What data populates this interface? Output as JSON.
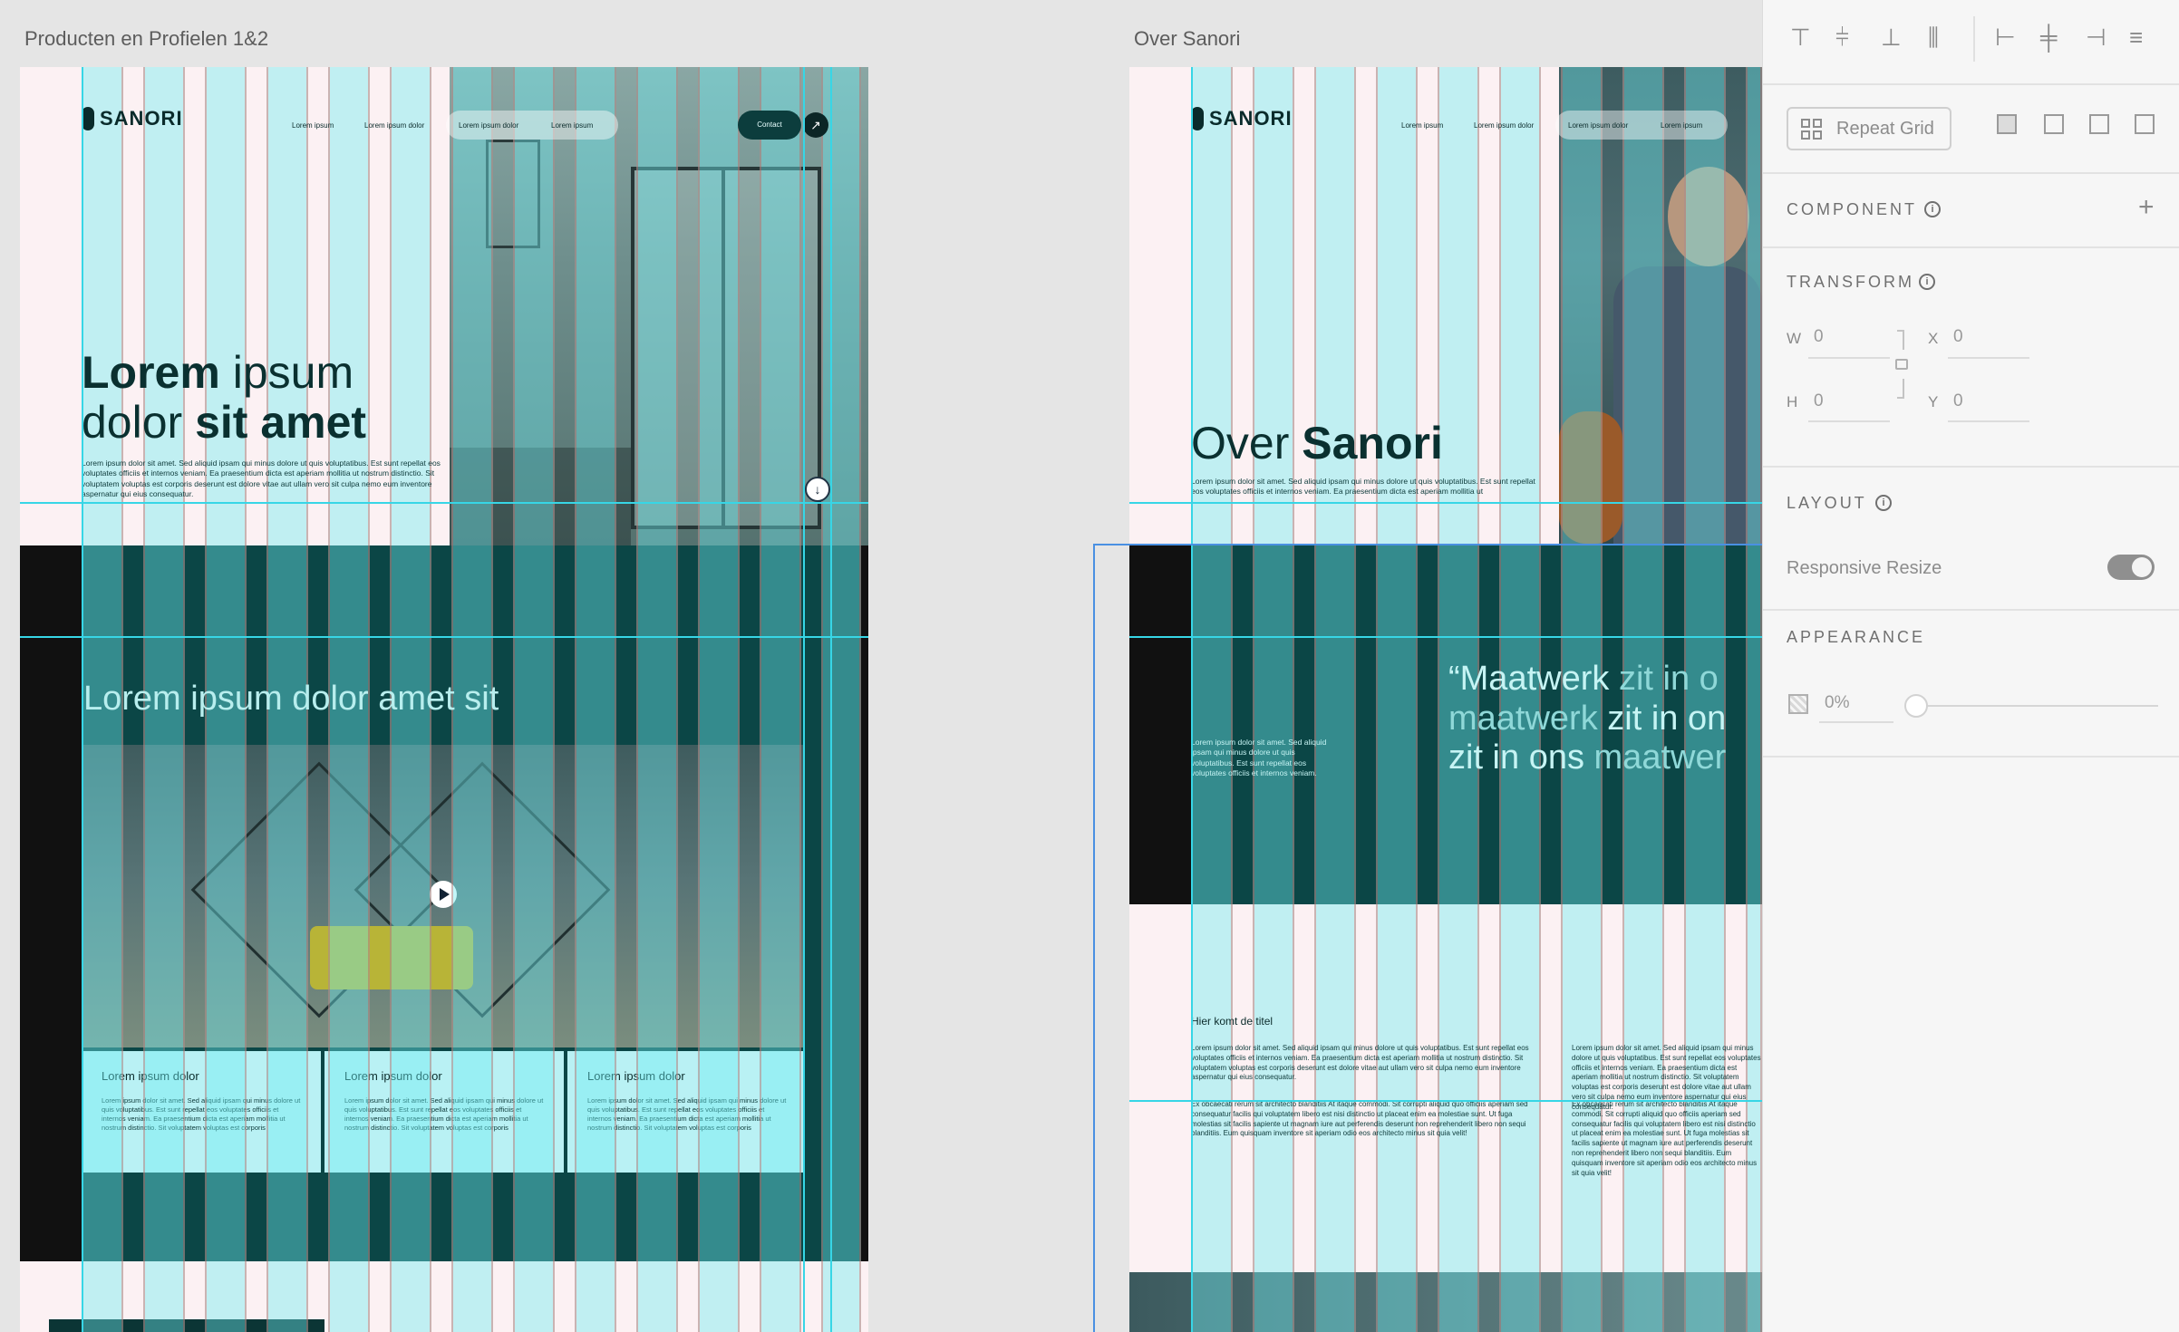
{
  "artboards": {
    "left": {
      "title": "Producten en Profielen 1&2",
      "logo": "SANORI",
      "nav": [
        "Lorem ipsum",
        "Lorem ipsum dolor",
        "Lorem ipsum dolor",
        "Lorem ipsum"
      ],
      "contact_label": "Contact",
      "hero_title_light1": "Lorem",
      "hero_title_light2": "ipsum",
      "hero_title_light3": "dolor",
      "hero_title_bold": "sit amet",
      "hero_body": "Lorem ipsum dolor sit amet. Sed aliquid ipsam qui minus dolore ut quis voluptatibus. Est sunt repellat eos voluptates officiis et internos veniam. Ea praesentium dicta est aperiam mollitia ut nostrum distinctio. Sit voluptatem voluptas est corporis deserunt est dolore vitae aut ullam vero sit culpa nemo eum inventore aspernatur qui eius consequatur.",
      "section_title": "Lorem ipsum dolor amet sit",
      "cards": [
        {
          "title": "Lorem ipsum dolor",
          "body": "Lorem ipsum dolor sit amet. Sed aliquid ipsam qui minus dolore ut quis voluptatibus. Est sunt repellat eos voluptates officiis et internos veniam. Ea praesentium dicta est aperiam mollitia ut nostrum distinctio. Sit voluptatem voluptas est corporis"
        },
        {
          "title": "Lorem ipsum dolor",
          "body": "Lorem ipsum dolor sit amet. Sed aliquid ipsam qui minus dolore ut quis voluptatibus. Est sunt repellat eos voluptates officiis et internos veniam. Ea praesentium dicta est aperiam mollitia ut nostrum distinctio. Sit voluptatem voluptas est corporis"
        },
        {
          "title": "Lorem ipsum dolor",
          "body": "Lorem ipsum dolor sit amet. Sed aliquid ipsam qui minus dolore ut quis voluptatibus. Est sunt repellat eos voluptates officiis et internos veniam. Ea praesentium dicta est aperiam mollitia ut nostrum distinctio. Sit voluptatem voluptas est corporis"
        }
      ]
    },
    "right": {
      "title": "Over Sanori",
      "logo": "SANORI",
      "nav": [
        "Lorem ipsum",
        "Lorem ipsum dolor",
        "Lorem ipsum dolor",
        "Lorem ipsum"
      ],
      "hero_title_light": "Over",
      "hero_title_bold": "Sanori",
      "hero_body": "Lorem ipsum dolor sit amet. Sed aliquid ipsam qui minus dolore ut quis voluptatibus. Est sunt repellat eos voluptates officiis et internos veniam. Ea praesentium dicta est aperiam mollitia ut",
      "quote_side_text": "Lorem ipsum dolor sit amet. Sed aliquid ipsam qui minus dolore ut quis voluptatibus. Est sunt repellat eos voluptates officiis et internos veniam.",
      "quote_line1_open": "“Maatwerk",
      "quote_line1_light": "zit in o",
      "quote_line2_light": "maatwerk",
      "quote_line2_bold": "zit in on",
      "quote_line3_bold": "zit in ons",
      "quote_line3_light": "maatwer",
      "content_title": "Hier komt de titel",
      "col1_p1": "Lorem ipsum dolor sit amet. Sed aliquid ipsam qui minus dolore ut quis voluptatibus. Est sunt repellat eos voluptates officiis et internos veniam. Ea praesentium dicta est aperiam mollitia ut nostrum distinctio. Sit voluptatem voluptas est corporis deserunt est dolore vitae aut ullam vero sit culpa nemo eum inventore aspernatur qui eius consequatur.",
      "col1_p2": "Ex obcaecati rerum sit architecto blanditiis At itaque commodi. Sit corrupti aliquid quo officiis aperiam sed consequatur facilis qui voluptatem libero est nisi distinctio ut placeat enim ea molestiae sunt. Ut fuga molestias sit facilis sapiente ut magnam iure aut perferendis deserunt non reprehenderit libero non sequi blanditiis. Eum quisquam inventore sit aperiam odio eos architecto minus sit quia velit!",
      "col2_p1": "Lorem ipsum dolor sit amet. Sed aliquid ipsam qui minus dolore ut quis voluptatibus. Est sunt repellat eos voluptates officiis et internos veniam. Ea praesentium dicta est aperiam mollitia ut nostrum distinctio. Sit voluptatem voluptas est corporis deserunt est dolore vitae aut ullam vero sit culpa nemo eum inventore aspernatur qui eius consequatur.",
      "col2_p2": "Ex obcaecati rerum sit architecto blanditiis At itaque commodi. Sit corrupti aliquid quo officiis aperiam sed consequatur facilis qui voluptatem libero est nisi distinctio ut placeat enim ea molestiae sunt. Ut fuga molestias sit facilis sapiente ut magnam iure aut perferendis deserunt non reprehenderit libero non sequi blanditiis. Eum quisquam inventore sit aperiam odio eos architecto minus sit quia velit!"
    }
  },
  "panel": {
    "repeat_grid_label": "Repeat Grid",
    "component_label": "COMPONENT",
    "transform_label": "TRANSFORM",
    "w_label": "W",
    "w_value": "0",
    "h_label": "H",
    "h_value": "0",
    "x_label": "X",
    "x_value": "0",
    "y_label": "Y",
    "y_value": "0",
    "layout_label": "LAYOUT",
    "responsive_resize_label": "Responsive Resize",
    "responsive_resize_on": true,
    "appearance_label": "APPEARANCE",
    "opacity_value": "0%"
  },
  "colors": {
    "grid_column": "#6eebf0",
    "grid_line": "#37d6e6",
    "dark_teal": "#0a3e3e",
    "artboard_bg": "#fcf1f3",
    "canvas_bg": "#e5e5e5"
  }
}
